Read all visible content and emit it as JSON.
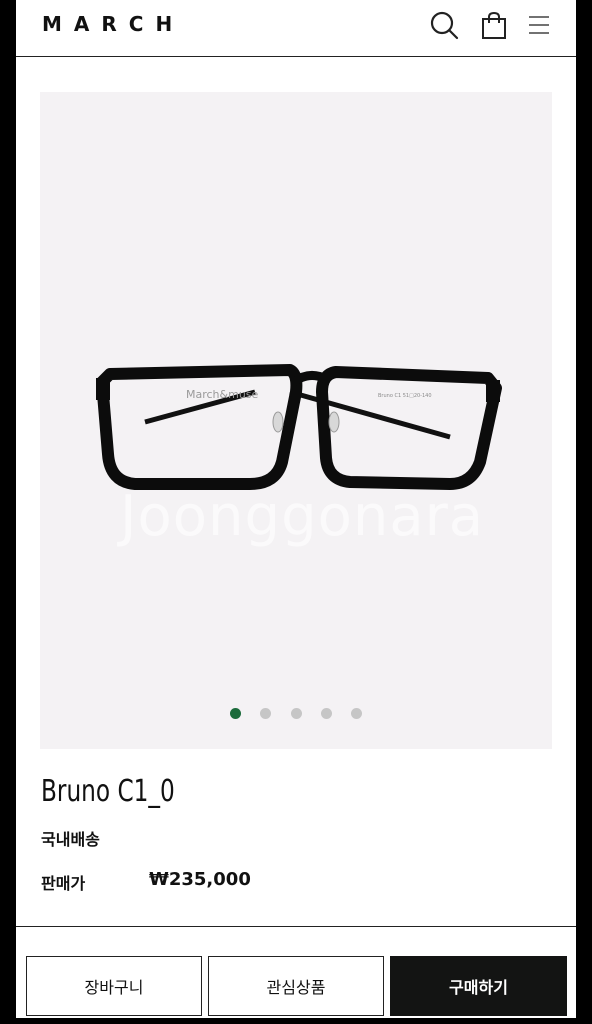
{
  "header": {
    "brand": "MARCH",
    "icons": [
      "search-icon",
      "shopping-bag-icon",
      "menu-icon"
    ]
  },
  "product": {
    "image": {
      "frame_engraving": "March&muse",
      "watermark": "Joonggonara",
      "slide_count": 5,
      "active_slide": 1
    },
    "name": "Bruno C1_0",
    "shipping": "국내배송",
    "price_label": "판매가",
    "price": "₩235,000"
  },
  "actions": {
    "cart_label": "장바구니",
    "wishlist_label": "관심상품",
    "buy_label": "구매하기"
  },
  "colors": {
    "active_dot": "#1c6b3b",
    "inactive_dot": "#c6c6c6",
    "buy_button": "#131413",
    "image_background": "#f4f2f4"
  }
}
